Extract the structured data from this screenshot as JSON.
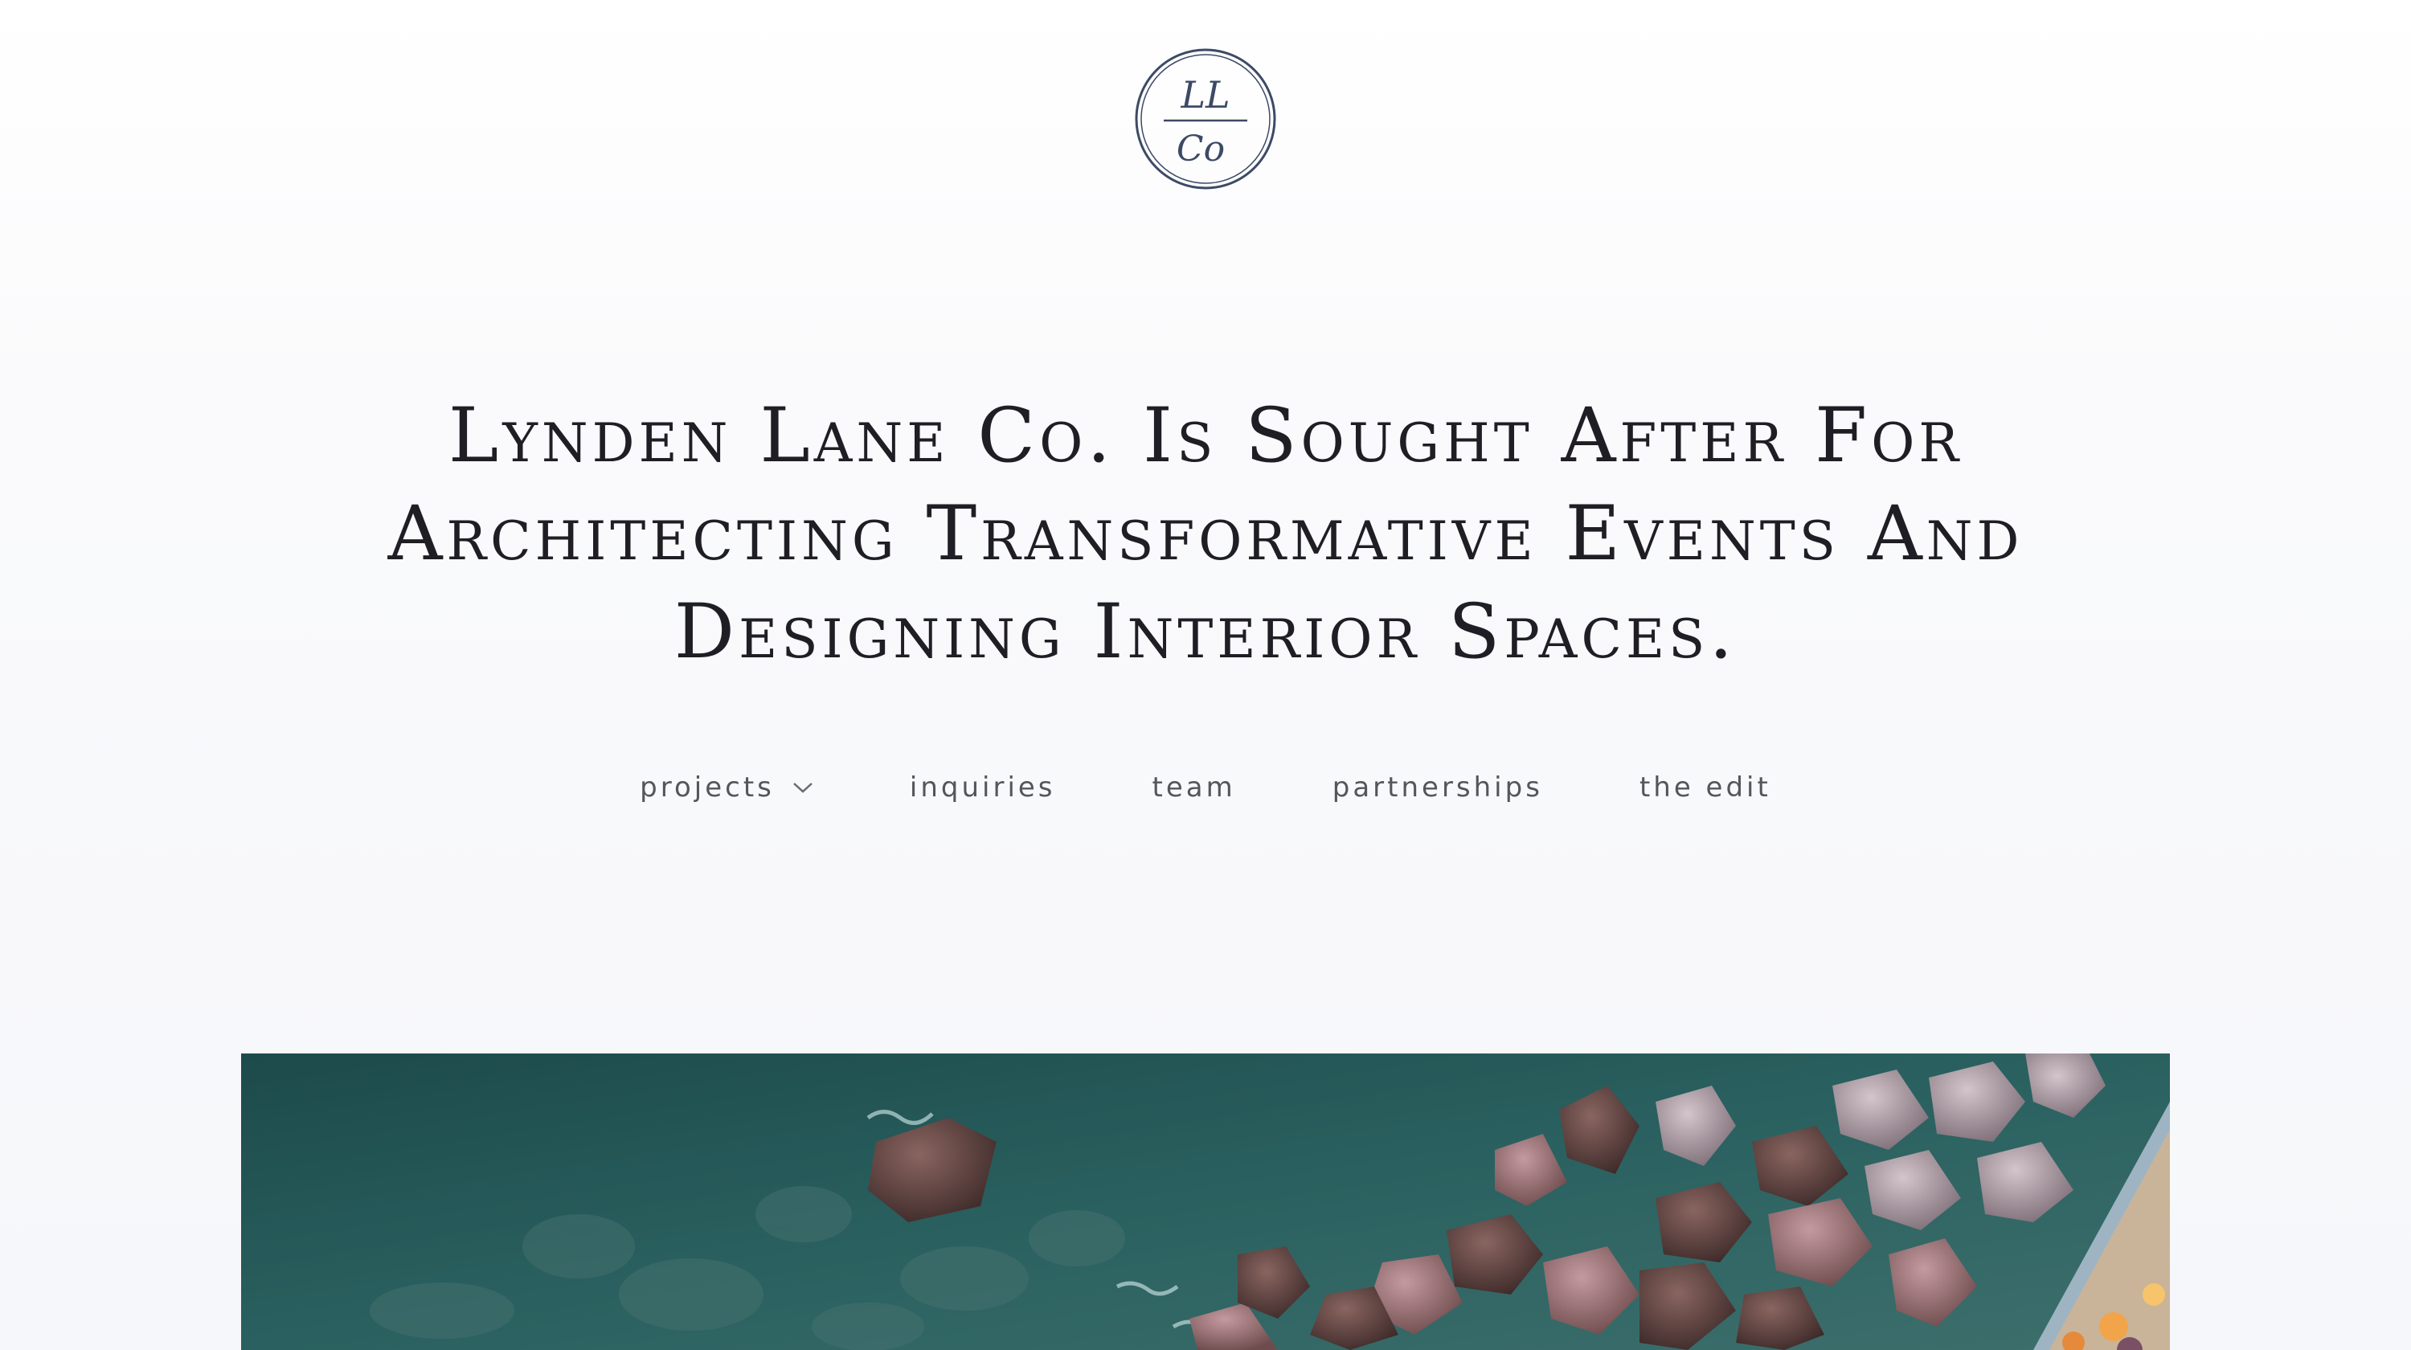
{
  "brand": {
    "logo_top": "LL",
    "logo_bottom": "Co",
    "logo_color": "#3d4a66"
  },
  "headline": {
    "text": "Lynden Lane Co. Is Sought After For Architecting Transformative Events And Designing Interior Spaces."
  },
  "nav": {
    "items": [
      {
        "label": "projects",
        "has_dropdown": true,
        "icon": "chevron-down-icon"
      },
      {
        "label": "inquiries"
      },
      {
        "label": "team"
      },
      {
        "label": "partnerships"
      },
      {
        "label": "the edit"
      }
    ]
  },
  "hero": {
    "palette": {
      "water_dark": "#1f4c4e",
      "water_mid": "#2f6a69",
      "rock_pink": "#b78a93",
      "rock_brown": "#5a3e3a",
      "deck": "#c8b59c",
      "rail": "#8fa3b3"
    }
  }
}
